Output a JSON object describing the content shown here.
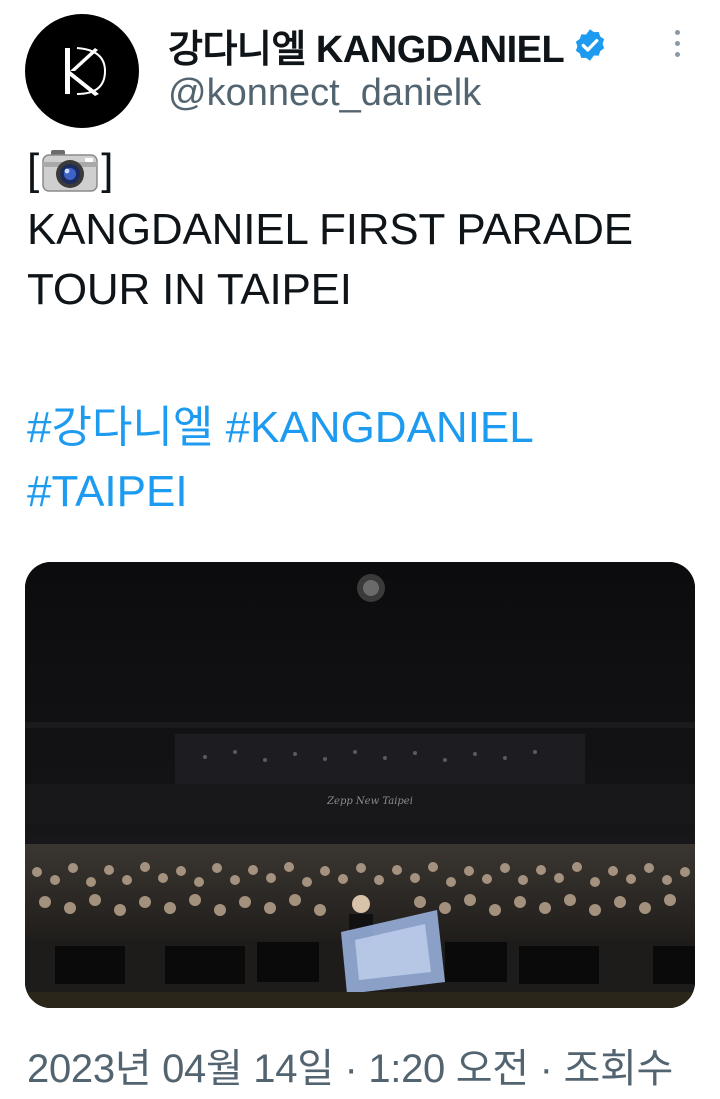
{
  "tweet": {
    "display_name": "강다니엘 KANGDANIEL",
    "handle": "@konnect_danielk",
    "camera_open": "[",
    "camera_close": "]",
    "title_line_1": "KANGDANIEL FIRST PARADE",
    "title_line_2": "TOUR IN TAIPEI",
    "hashtags": [
      "#강다니엘",
      "#KANGDANIEL",
      "#TAIPEI"
    ],
    "media": {
      "venue_sign": "Zepp New Taipei"
    },
    "timestamp": "2023년 04월 14일 · 1:20 오전 · 조회수"
  },
  "colors": {
    "link": "#1d9bf0",
    "verified": "#1d9bf0",
    "secondary_text": "#536471"
  },
  "icons": {
    "avatar": "kd-monogram-logo",
    "verified": "verified-badge-icon",
    "more": "more-vertical-icon",
    "camera": "camera-emoji-icon"
  }
}
